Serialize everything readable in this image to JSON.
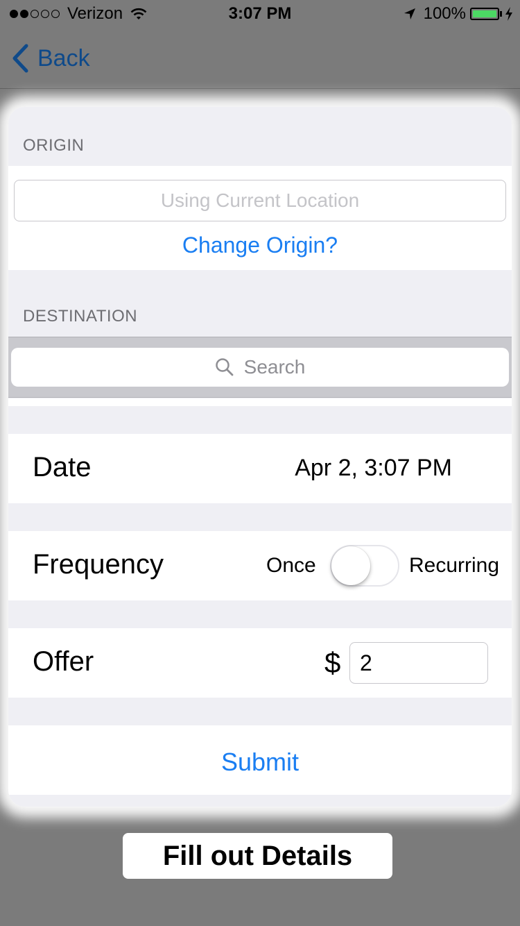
{
  "status_bar": {
    "carrier": "Verizon",
    "signal_bars_filled": 2,
    "signal_bars_total": 5,
    "time": "3:07 PM",
    "battery_percent": "100%",
    "icons": [
      "wifi-icon",
      "location-arrow-icon",
      "battery-icon",
      "charging-bolt-icon"
    ]
  },
  "nav": {
    "back_label": "Back"
  },
  "origin": {
    "header": "ORIGIN",
    "placeholder": "Using Current Location",
    "change_label": "Change Origin?"
  },
  "destination": {
    "header": "DESTINATION",
    "search_placeholder": "Search"
  },
  "date_row": {
    "label": "Date",
    "value": "Apr 2, 3:07 PM"
  },
  "frequency_row": {
    "label": "Frequency",
    "option_left": "Once",
    "option_right": "Recurring",
    "toggle_on": false
  },
  "offer_row": {
    "label": "Offer",
    "currency": "$",
    "value": "2"
  },
  "submit_label": "Submit",
  "caption": "Fill out Details",
  "colors": {
    "accent": "#1a7ef2",
    "back_link": "#0f4a8a",
    "battery": "#4cd964",
    "overlay": "#7b7b7b"
  }
}
